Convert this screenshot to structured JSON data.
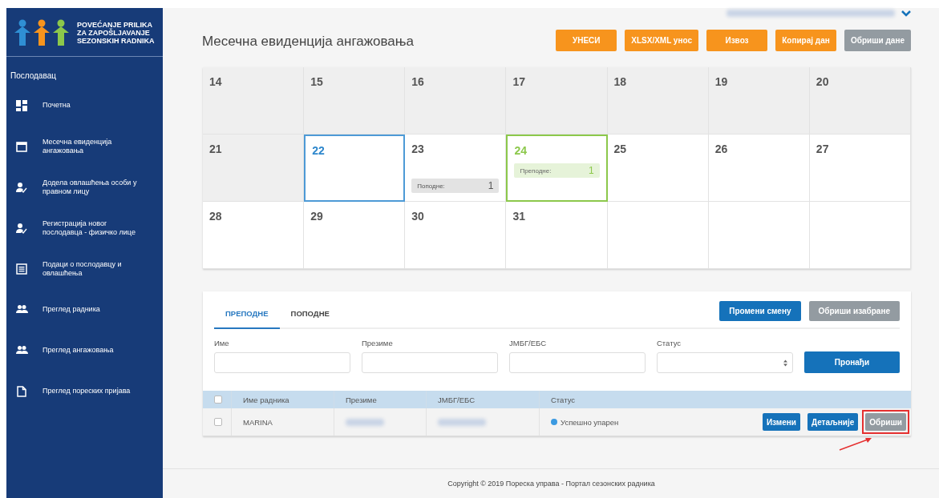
{
  "logo": {
    "lines": [
      "POVEĆANJE PRILIKA",
      "ZA ZAPOŠLJAVANJE",
      "SEZONSKIH RADNIKA"
    ]
  },
  "sidebar": {
    "section": "Послодавац",
    "items": [
      {
        "label": "Почетна",
        "kind": "dashboard"
      },
      {
        "label": "Месечна евиденција ангажовања",
        "kind": "calendar"
      },
      {
        "label": "Додела овлашћења особи у правном лицу",
        "kind": "user"
      },
      {
        "label": "Регистрација новог послодавца - физичко лице",
        "kind": "user"
      },
      {
        "label": "Подаци о послодавцу и овлашћења",
        "kind": "list"
      },
      {
        "label": "Преглед радника",
        "kind": "people"
      },
      {
        "label": "Преглед ангажовања",
        "kind": "people"
      },
      {
        "label": "Преглед пореских пријава",
        "kind": "file"
      }
    ]
  },
  "header": {
    "title": "Месечна евиденција ангажовања",
    "user_blurred": true,
    "buttons": [
      {
        "label": "УНЕСИ",
        "kind": "orange"
      },
      {
        "label": "XLSX/XML унос",
        "kind": "orange"
      },
      {
        "label": "Извоз",
        "kind": "orange"
      },
      {
        "label": "Копирај дан",
        "kind": "orange"
      },
      {
        "label": "Обриши дане",
        "kind": "gray"
      }
    ]
  },
  "calendar": {
    "weeks": [
      [
        {
          "day": "14",
          "past": true
        },
        {
          "day": "15",
          "past": true
        },
        {
          "day": "16",
          "past": true
        },
        {
          "day": "17",
          "past": true
        },
        {
          "day": "18",
          "past": true
        },
        {
          "day": "19",
          "past": true
        },
        {
          "day": "20",
          "past": true
        }
      ],
      [
        {
          "day": "21",
          "past": true
        },
        {
          "day": "22",
          "today": true
        },
        {
          "day": "23",
          "events": [
            {
              "label": "Поподне:",
              "count": "1",
              "kind": "afternoon"
            }
          ]
        },
        {
          "day": "24",
          "selected": true,
          "events": [
            {
              "label": "Преподне:",
              "count": "1",
              "kind": "morning"
            }
          ]
        },
        {
          "day": "25"
        },
        {
          "day": "26"
        },
        {
          "day": "27"
        }
      ],
      [
        {
          "day": "28"
        },
        {
          "day": "29"
        },
        {
          "day": "30"
        },
        {
          "day": "31"
        }
      ]
    ]
  },
  "shifts": {
    "tabs": [
      {
        "label": "ПРЕПОДНЕ",
        "selected": true
      },
      {
        "label": "ПОПОДНЕ",
        "selected": false
      }
    ],
    "buttons": [
      {
        "label": "Промени смену",
        "kind": "blue"
      },
      {
        "label": "Обриши изабране",
        "kind": "gray"
      }
    ],
    "filters": [
      {
        "label": "Име",
        "kind": "text"
      },
      {
        "label": "Презиме",
        "kind": "text"
      },
      {
        "label": "ЈМБГ/ЕБС",
        "kind": "text"
      },
      {
        "label": "Статус",
        "kind": "select"
      }
    ],
    "search_button": "Пронађи",
    "table": {
      "all_checked": false,
      "columns": [
        "Име радника",
        "Презиме",
        "ЈМБГ/ЕБС",
        "Статус"
      ],
      "rows": [
        {
          "checked": false,
          "name": "MARINA",
          "surname_blurred": true,
          "id_blurred": true,
          "status": "Успешно упарен",
          "kind": "paired",
          "actions": [
            {
              "label": "Измени",
              "kind": "blue",
              "highlighted": false
            },
            {
              "label": "Детаљније",
              "kind": "blue",
              "highlighted": false
            },
            {
              "label": "Обриши",
              "kind": "gray",
              "highlighted": true
            }
          ]
        }
      ]
    }
  },
  "footer": "Copyright © 2019 Пореска управа - Портал сезонских радника"
}
